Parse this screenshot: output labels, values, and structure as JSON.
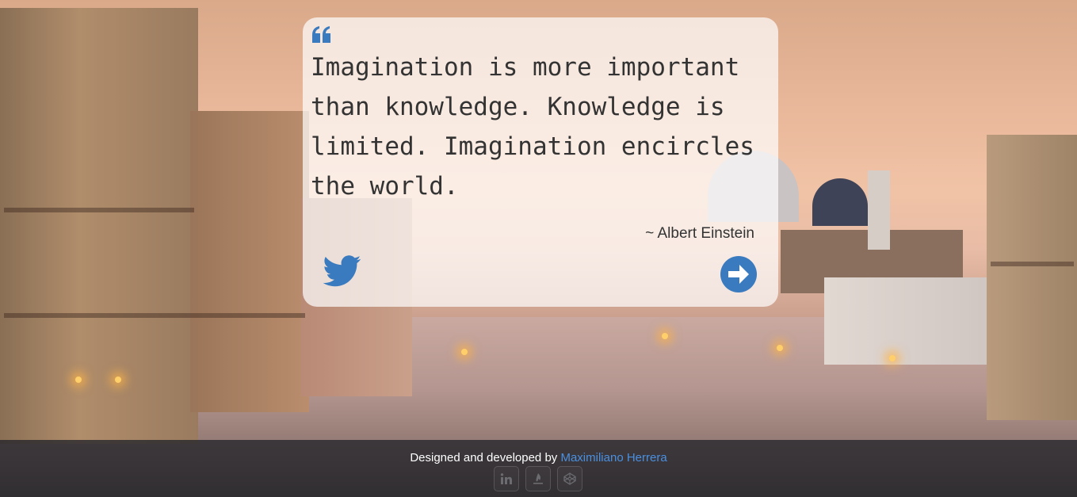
{
  "quote": {
    "text": "Imagination is more important than knowledge. Knowledge is limited. Imagination encircles the world.",
    "author": "~ Albert Einstein"
  },
  "actions": {
    "tweet_icon": "twitter-icon",
    "next_icon": "arrow-right-circle-icon"
  },
  "footer": {
    "credit_prefix": "Designed and developed by ",
    "credit_name": "Maximiliano Herrera",
    "social": [
      {
        "icon": "linkedin-icon",
        "label": "in"
      },
      {
        "icon": "freecodecamp-icon",
        "label": ""
      },
      {
        "icon": "codepen-icon",
        "label": ""
      }
    ]
  },
  "colors": {
    "accent": "#3a7bbf",
    "link": "#4a90e2",
    "text": "#333333"
  }
}
